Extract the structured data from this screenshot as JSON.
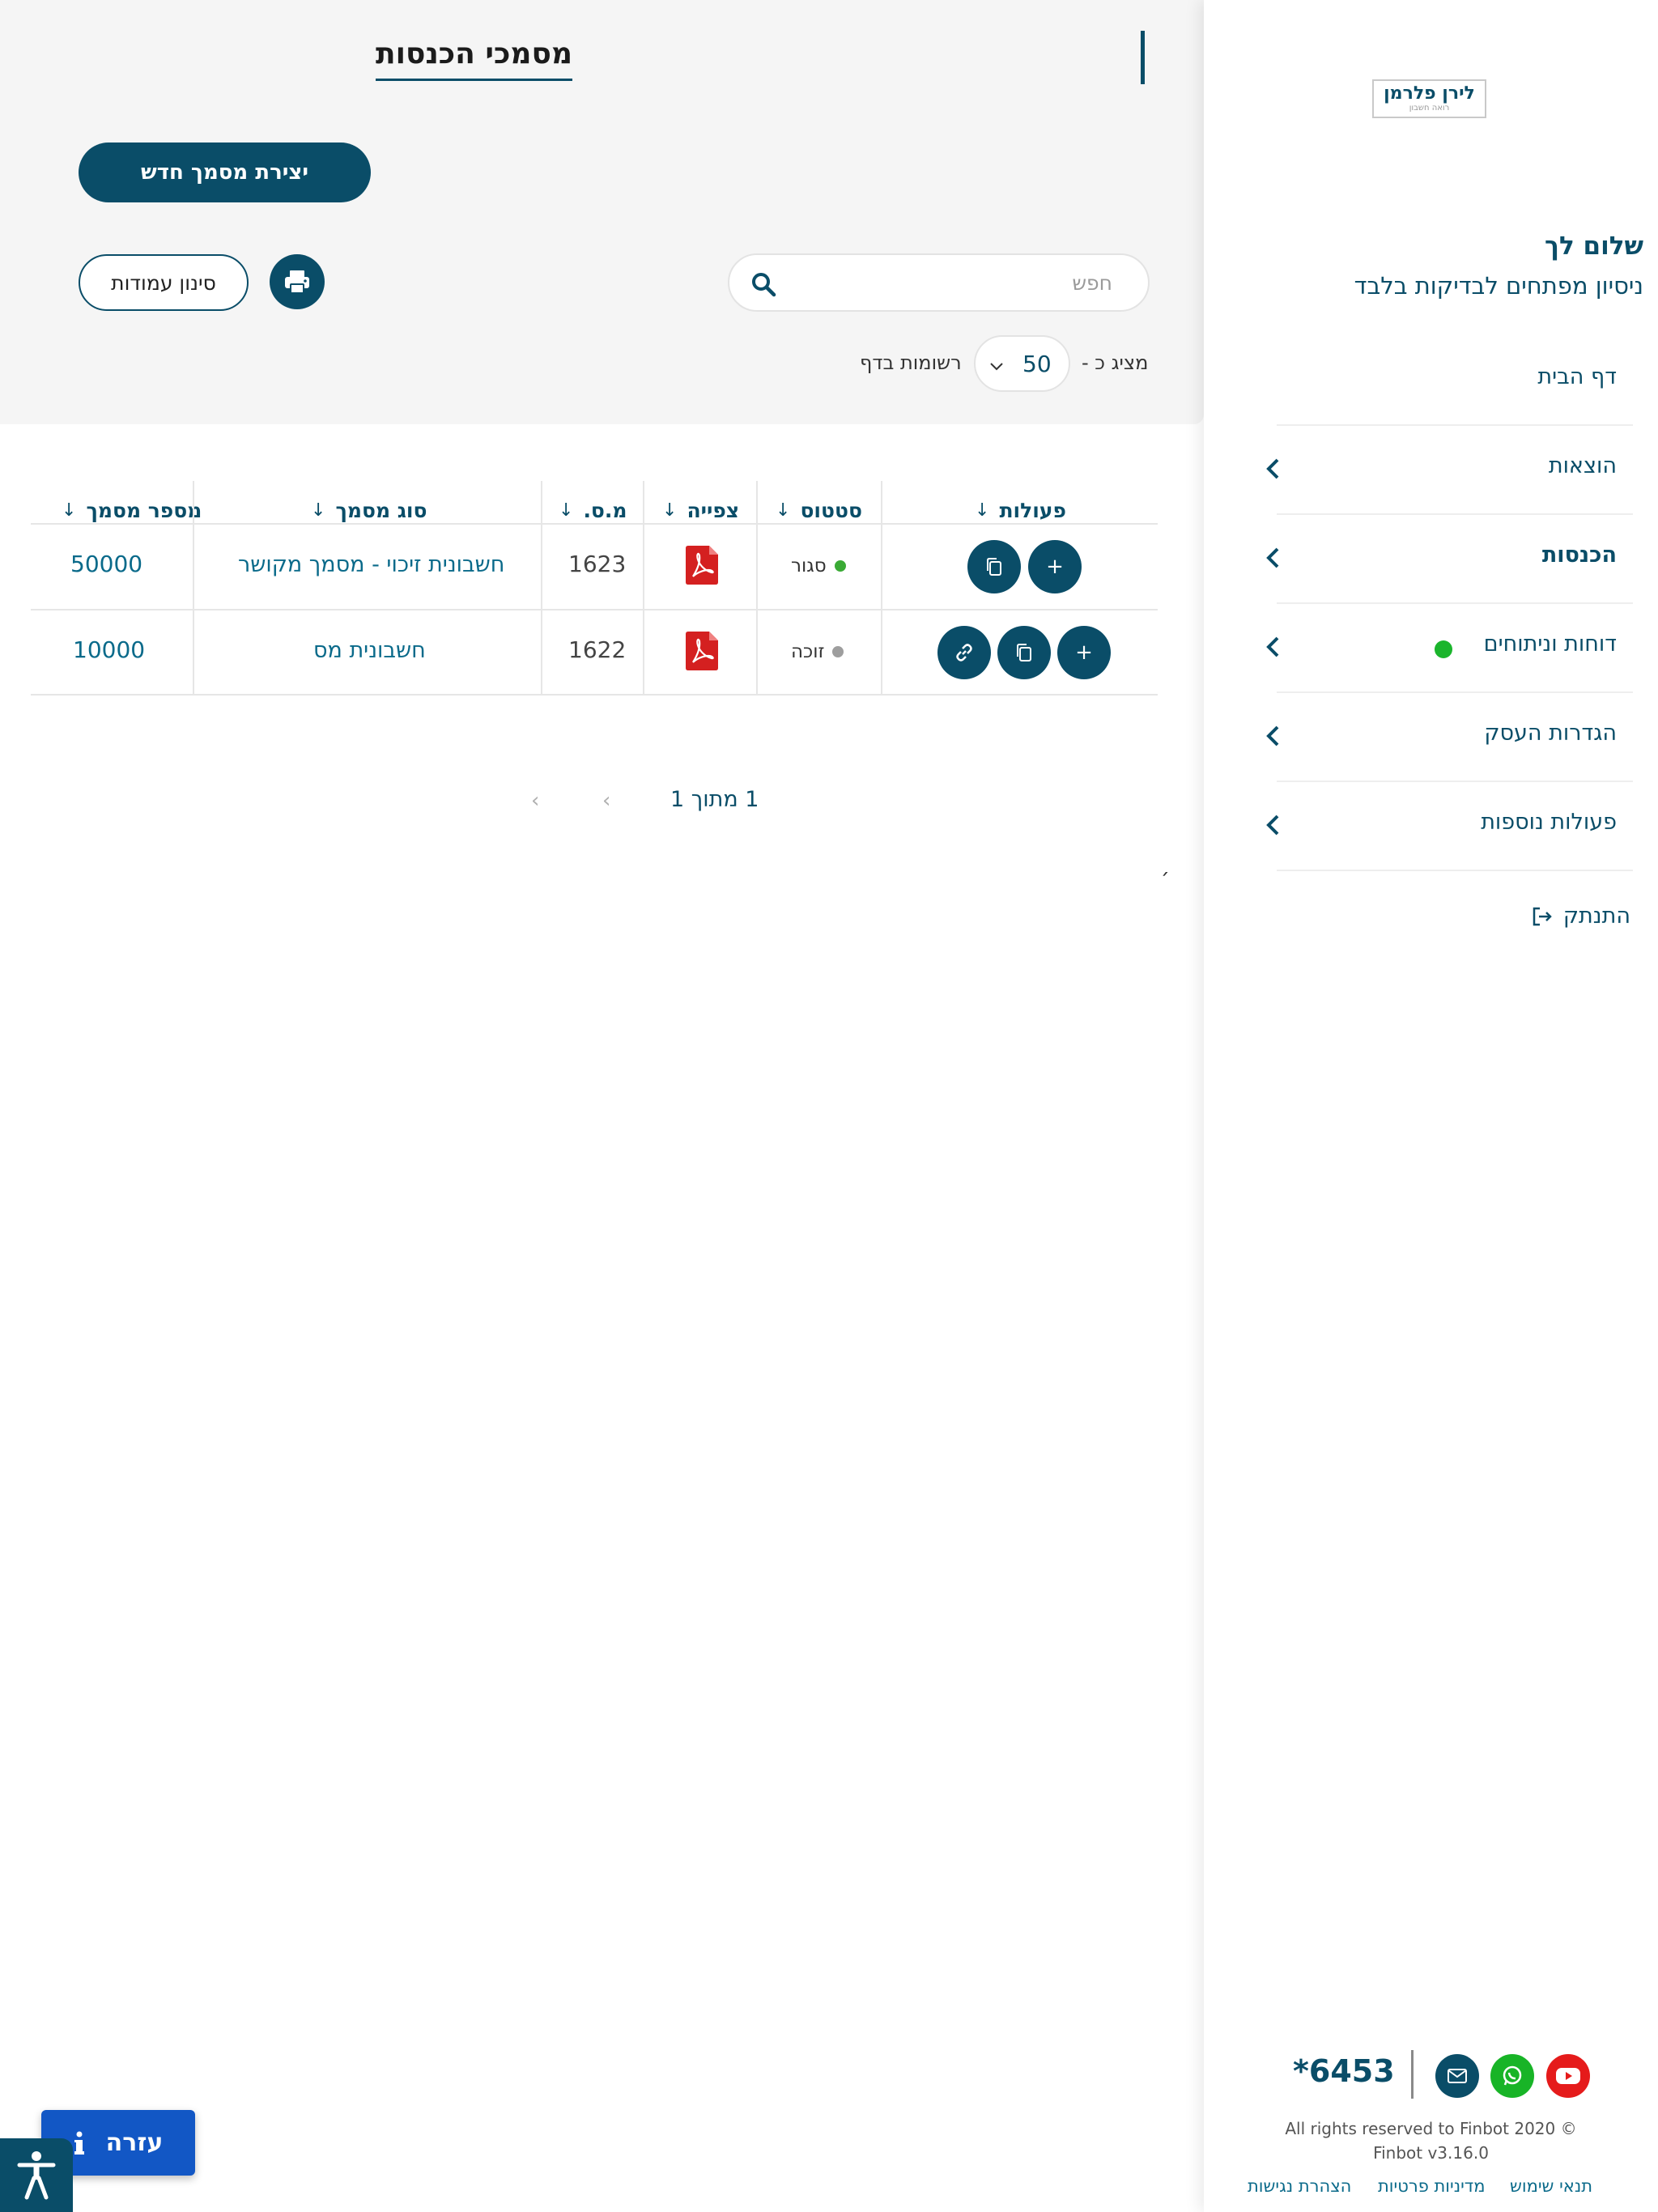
{
  "page": {
    "title": "מסמכי הכנסות",
    "create_button": "יצירת מסמך חדש",
    "columns_button": "סינון עמודות",
    "search_placeholder": "חפש",
    "pagesize_prefix": "מציג כ -",
    "pagesize_value": "50",
    "pagesize_suffix": "רשומות בדף"
  },
  "table": {
    "headers": {
      "doc_number": "מספר מסמך",
      "doc_type": "סוג מסמך",
      "ms": "מ.ס.",
      "view": "צפייה",
      "status": "סטטוס",
      "actions": "פעולות"
    },
    "rows": [
      {
        "doc_number": "50000",
        "doc_type": "חשבונית זיכוי - מסמך מקושר",
        "ms": "1623",
        "status": "סגור",
        "status_color": "#3aaa35"
      },
      {
        "doc_number": "10000",
        "doc_type": "חשבונית מס",
        "ms": "1622",
        "status": "זוכה",
        "status_color": "#9e9e9e"
      }
    ]
  },
  "pagination": {
    "text": "1 מתוך 1"
  },
  "stray_text": "׳",
  "sidebar": {
    "logo_name": "לירן פלרמן",
    "logo_sub": "רואה חשבון",
    "greeting": "שלום לך",
    "account_name": "ניסיון מפתחים לבדיקות בלבד",
    "nav": [
      {
        "label": "דף הבית"
      },
      {
        "label": "הוצאות"
      },
      {
        "label": "הכנסות"
      },
      {
        "label": "דוחות וניתוחים"
      },
      {
        "label": "הגדרות העסק"
      },
      {
        "label": "פעולות נוספות"
      }
    ],
    "logout": "התנתק",
    "phone": "*6453",
    "rights_line1": "All rights reserved to Finbot 2020 ©",
    "rights_line2": "Finbot v3.16.0",
    "footer_links": [
      "תנאי שימוש",
      "מדיניות פרטיות",
      "הצהרת נגישות"
    ]
  },
  "help": {
    "label": "עזרה"
  },
  "colors": {
    "primary": "#0a4d68",
    "help_blue": "#1257c5",
    "active_green": "#1bb52c"
  }
}
